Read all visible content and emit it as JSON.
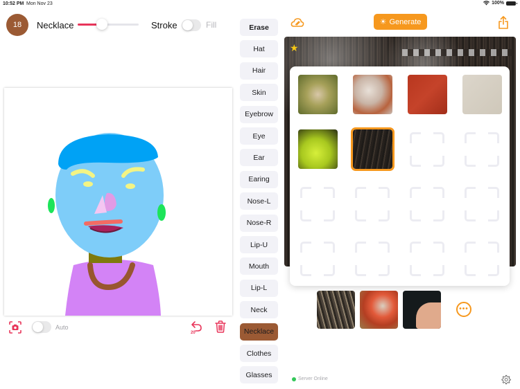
{
  "status_bar": {
    "time": "10:52 PM",
    "date": "Mon Nov 23",
    "battery": "100%"
  },
  "toolbar": {
    "brush_size": "18",
    "brush_color": "#9b5a34",
    "current_layer": "Necklace",
    "size_slider_fraction": 0.4,
    "stroke_label": "Stroke",
    "fill_label": "Fill",
    "fill_toggle_on": false
  },
  "canvas_tools": {
    "camera_icon": "camera-viewfinder-icon",
    "auto_label": "Auto",
    "auto_toggle_on": false,
    "undo_count": "20",
    "accent_color": "#e8355a"
  },
  "layers": [
    {
      "label": "Erase",
      "bold": true,
      "active": false
    },
    {
      "label": "Hat",
      "active": false
    },
    {
      "label": "Hair",
      "active": false
    },
    {
      "label": "Skin",
      "active": false
    },
    {
      "label": "Eyebrow",
      "active": false
    },
    {
      "label": "Eye",
      "active": false
    },
    {
      "label": "Ear",
      "active": false
    },
    {
      "label": "Earing",
      "active": false
    },
    {
      "label": "Nose-L",
      "active": false
    },
    {
      "label": "Nose-R",
      "active": false
    },
    {
      "label": "Lip-U",
      "active": false
    },
    {
      "label": "Mouth",
      "active": false
    },
    {
      "label": "Lip-L",
      "active": false
    },
    {
      "label": "Neck",
      "active": false
    },
    {
      "label": "Necklace",
      "active": true
    },
    {
      "label": "Clothes",
      "active": false
    },
    {
      "label": "Glasses",
      "active": false
    }
  ],
  "right_panel": {
    "generate_label": "Generate",
    "accent_color": "#f6981e",
    "textures": {
      "filled_count": 6,
      "selected_index": 5,
      "total_slots": 16
    },
    "history_count": 3,
    "more_label": "•••",
    "server_status": "Server Online",
    "server_status_color": "#34c759"
  }
}
